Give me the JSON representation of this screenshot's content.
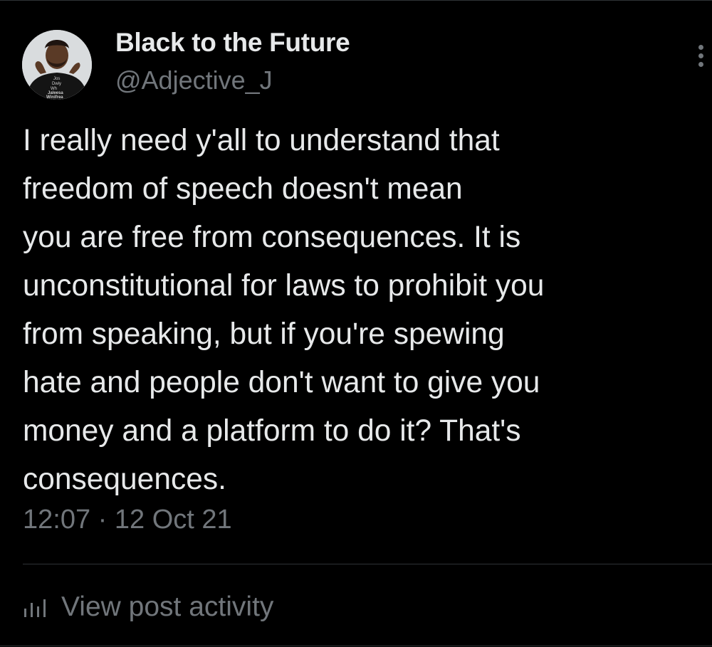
{
  "tweet": {
    "author": {
      "name": "Black to the Future",
      "handle": "@Adjective_J",
      "avatar_shirt_text": [
        "Jos",
        "Dwiy",
        "Wh",
        "Jaleesa",
        "Winifrea"
      ]
    },
    "text_lines": [
      "I really need y'all to understand that",
      "freedom of speech doesn't mean",
      "you are free from consequences. It is",
      "unconstitutional for laws to prohibit you",
      "from speaking, but if you're spewing",
      "hate and people don't want to give you",
      "money and a platform to do it? That's",
      "consequences."
    ],
    "timestamp": "12:07 · 12 Oct 21"
  },
  "actions": {
    "more_icon": "more-vertical-icon",
    "activity_icon": "analytics-bars-icon",
    "activity_label": "View post activity"
  },
  "colors": {
    "background": "#000000",
    "primary_text": "#e7e9ea",
    "secondary_text": "#71767b",
    "divider": "#2f3336"
  }
}
